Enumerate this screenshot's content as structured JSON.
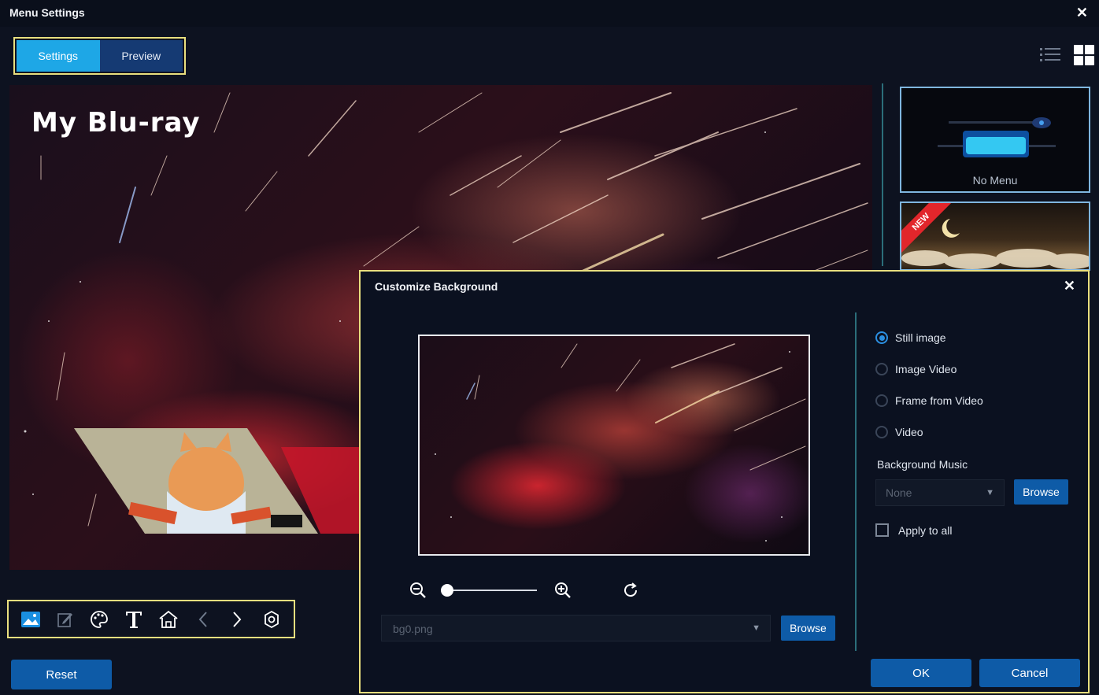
{
  "window": {
    "title": "Menu Settings",
    "close_glyph": "✕"
  },
  "mode_tabs": [
    {
      "label": "Settings",
      "active": true
    },
    {
      "label": "Preview",
      "active": false
    }
  ],
  "view_toggle": {
    "list_icon": "list-view-icon",
    "grid_icon": "grid-view-icon",
    "selected": "grid"
  },
  "preview": {
    "menu_title": "My Blu-ray"
  },
  "templates": {
    "no_menu_label": "No Menu",
    "new_badge": "NEW"
  },
  "toolbar": {
    "icons": [
      "background-image-icon",
      "edit-icon",
      "palette-icon",
      "text-icon",
      "home-icon",
      "previous-icon",
      "next-icon",
      "settings-icon"
    ]
  },
  "reset_label": "Reset",
  "dialog": {
    "title": "Customize Background",
    "close_glyph": "✕",
    "background_types": [
      {
        "label": "Still image",
        "checked": true
      },
      {
        "label": "Image Video",
        "checked": false
      },
      {
        "label": "Frame from Video",
        "checked": false
      },
      {
        "label": "Video",
        "checked": false
      }
    ],
    "background_music_label": "Background Music",
    "music_value": "None",
    "music_browse_label": "Browse",
    "apply_to_all_label": "Apply to all",
    "apply_to_all_checked": false,
    "image_file": "bg0.png",
    "image_browse_label": "Browse",
    "zoom_level": 0.0,
    "ok_label": "OK",
    "cancel_label": "Cancel"
  },
  "colors": {
    "accent_blue": "#1ea7e6",
    "button_blue": "#0e5ba7",
    "highlight_yellow": "#e9df7e",
    "background": "#0d1220"
  }
}
